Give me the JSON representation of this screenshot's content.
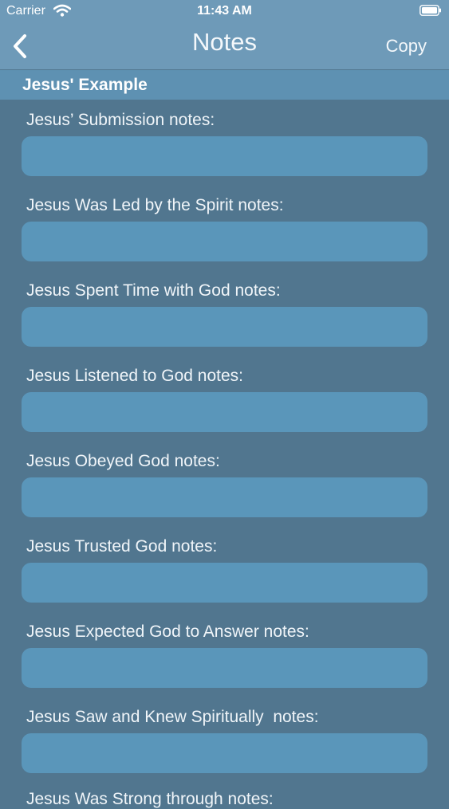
{
  "status_bar": {
    "carrier": "Carrier",
    "time": "11:43 AM"
  },
  "nav": {
    "title": "Notes",
    "copy_label": "Copy"
  },
  "section": {
    "title": "Jesus' Example"
  },
  "fields": [
    {
      "label": "Jesus’ Submission notes:",
      "value": ""
    },
    {
      "label": "Jesus Was Led by the Spirit notes:",
      "value": ""
    },
    {
      "label": "Jesus Spent Time with God notes:",
      "value": ""
    },
    {
      "label": "Jesus Listened to God notes:",
      "value": ""
    },
    {
      "label": "Jesus Obeyed God notes:",
      "value": ""
    },
    {
      "label": "Jesus Trusted God notes:",
      "value": ""
    },
    {
      "label": "Jesus Expected God to Answer notes:",
      "value": ""
    },
    {
      "label": "Jesus Saw and Knew Spiritually  notes:",
      "value": ""
    },
    {
      "label": "Jesus Was Strong through notes:",
      "value": ""
    }
  ],
  "colors": {
    "background": "#51768f",
    "nav_bar": "#6e9ab8",
    "section_header": "#5e91b2",
    "input_fill": "#5a96ba"
  }
}
